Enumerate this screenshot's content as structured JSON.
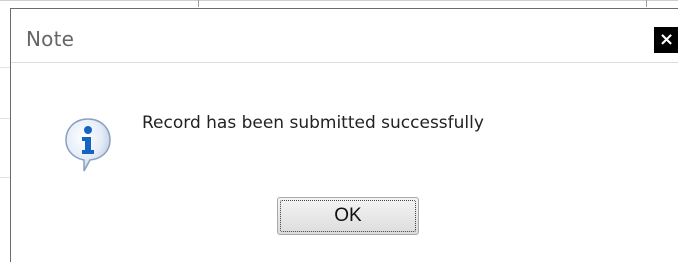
{
  "dialog": {
    "title": "Note",
    "close_icon": "close-icon",
    "message": "Record has been submitted successfully",
    "message_icon": "info-icon",
    "ok_label": "OK"
  },
  "colors": {
    "title_text": "#666666",
    "close_button_bg": "#000000",
    "info_icon_fill": "#1565c0",
    "border": "#6b6b6b"
  }
}
